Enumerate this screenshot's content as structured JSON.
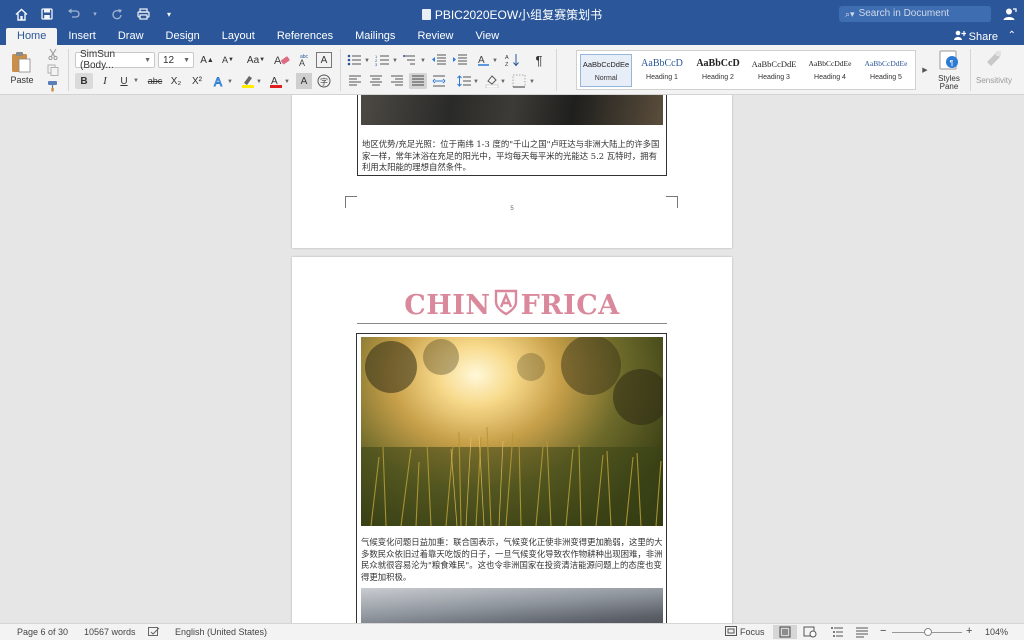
{
  "window": {
    "title": "PBIC2020EOW小组复赛策划书",
    "search_placeholder": "Search in Document"
  },
  "tabs": [
    "Home",
    "Insert",
    "Draw",
    "Design",
    "Layout",
    "References",
    "Mailings",
    "Review",
    "View"
  ],
  "active_tab": "Home",
  "share_label": "Share",
  "ribbon": {
    "paste_label": "Paste",
    "font_name": "SimSun (Body...",
    "font_size": "12",
    "styles": [
      {
        "preview": "AaBbCcDdEe",
        "name": "Normal"
      },
      {
        "preview": "AaBbCcD",
        "name": "Heading 1"
      },
      {
        "preview": "AaBbCcD",
        "name": "Heading 2"
      },
      {
        "preview": "AaBbCcDdE",
        "name": "Heading 3"
      },
      {
        "preview": "AaBbCcDdEe",
        "name": "Heading 4"
      },
      {
        "preview": "AaBbCcDdEe",
        "name": "Heading 5"
      }
    ],
    "styles_pane_label": "Styles\nPane",
    "sensitivity_label": "Sensitivity",
    "bold_label": "B",
    "italic_label": "I",
    "underline_label": "U",
    "strike_label": "abc",
    "sub_label": "X₂",
    "sup_label": "X²"
  },
  "document": {
    "page5_caption": "地区优势/充足光照：位于南纬 1-3 度的\"千山之国\"卢旺达与非洲大陆上的许多国家一样，常年沐浴在充足的阳光中，平均每天每平米的光能达 5.2 瓦特时，拥有利用太阳能的理想自然条件。",
    "page5_number": "5",
    "logo_left": "CHIN",
    "logo_right": "FRICA",
    "page6_caption": "气候变化问题日益加重：联合国表示，气候变化正使非洲变得更加脆弱，这里的大多数民众依旧过着靠天吃饭的日子，一旦气候变化导致农作物耕种出现困难，非洲民众就很容易沦为\"粮食难民\"。这也令非洲国家在投资清洁能源问题上的态度也变得更加积极。"
  },
  "status": {
    "page": "Page 6 of 30",
    "words": "10567 words",
    "language": "English (United States)",
    "focus": "Focus",
    "zoom": "104%"
  },
  "colors": {
    "accent": "#2b579a",
    "logo": "#d9899b"
  }
}
